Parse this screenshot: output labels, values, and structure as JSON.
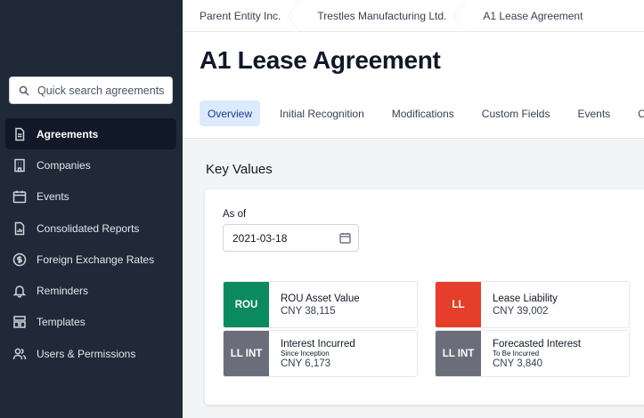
{
  "sidebar": {
    "search_placeholder": "Quick search agreements",
    "items": [
      {
        "label": "Agreements",
        "icon": "document-icon",
        "active": true
      },
      {
        "label": "Companies",
        "icon": "building-icon"
      },
      {
        "label": "Events",
        "icon": "calendar-icon"
      },
      {
        "label": "Consolidated Reports",
        "icon": "report-icon"
      },
      {
        "label": "Foreign Exchange Rates",
        "icon": "dollar-circle-icon"
      },
      {
        "label": "Reminders",
        "icon": "bell-icon"
      },
      {
        "label": "Templates",
        "icon": "template-icon"
      },
      {
        "label": "Users & Permissions",
        "icon": "users-icon"
      }
    ]
  },
  "breadcrumb": [
    "Parent Entity Inc.",
    "Trestles Manufacturing Ltd.",
    "A1 Lease Agreement"
  ],
  "page_title": "A1 Lease Agreement",
  "tabs": [
    "Overview",
    "Initial Recognition",
    "Modifications",
    "Custom Fields",
    "Events",
    "C"
  ],
  "key_values": {
    "section_title": "Key Values",
    "as_of_label": "As of",
    "as_of_date": "2021-03-18",
    "cards": [
      {
        "tag": "ROU",
        "label": "ROU Asset Value",
        "sub": "",
        "value": "CNY 38,115",
        "color": "#0b8a5f"
      },
      {
        "tag": "LL",
        "label": "Lease Liability",
        "sub": "",
        "value": "CNY 39,002",
        "color": "#e53e2b"
      },
      {
        "tag": "LL INT",
        "label": "Interest Incurred",
        "sub": "Since Inception",
        "value": "CNY 6,173",
        "color": "#6b6e7a"
      },
      {
        "tag": "LL INT",
        "label": "Forecasted Interest",
        "sub": "To Be Incurred",
        "value": "CNY 3,840",
        "color": "#6b6e7a"
      }
    ]
  }
}
